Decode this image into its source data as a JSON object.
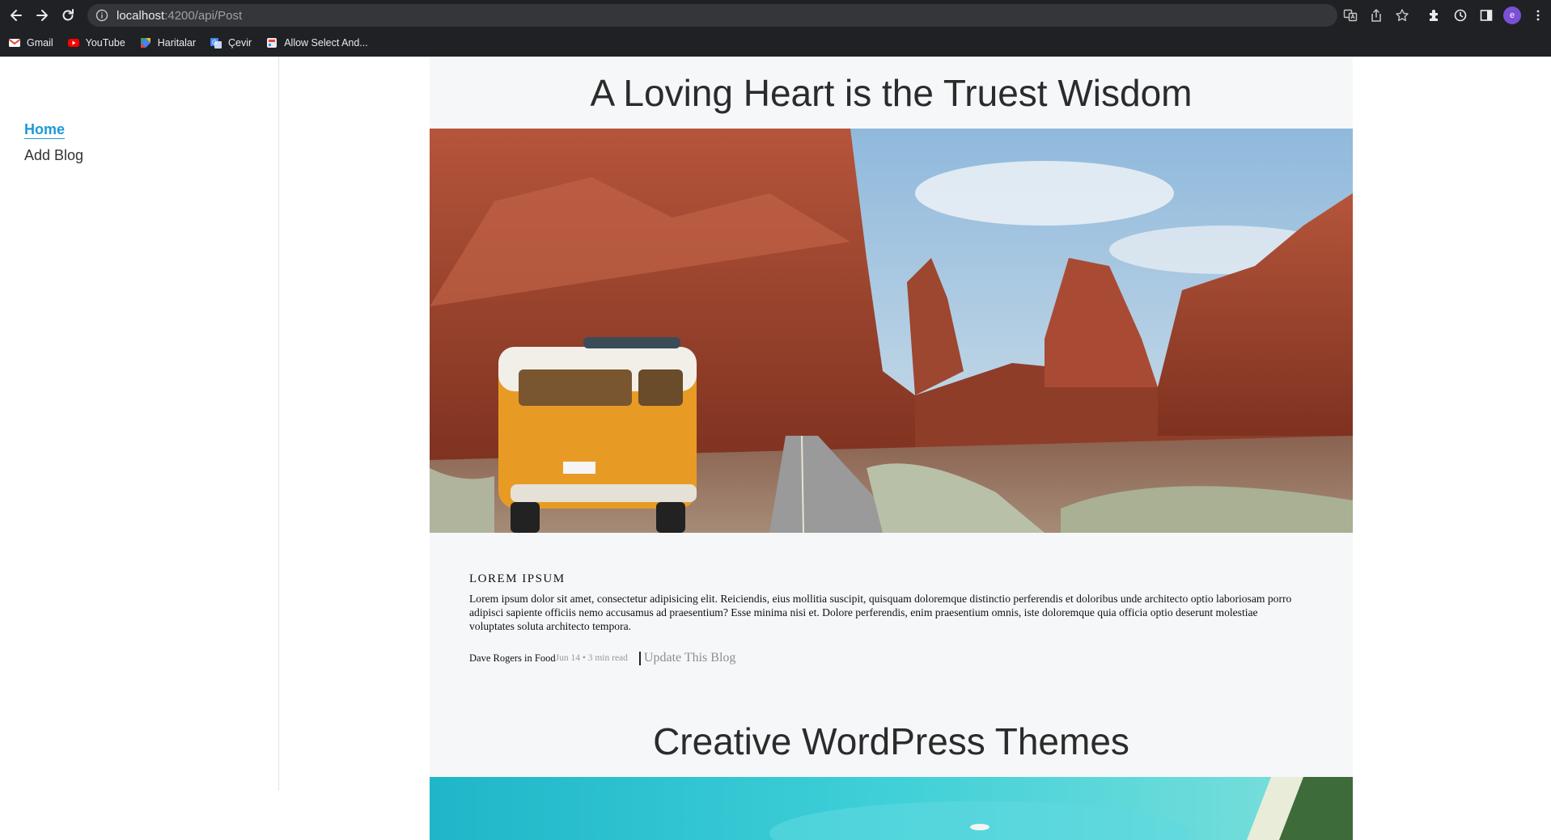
{
  "browser": {
    "url_host": "localhost",
    "url_path": ":4200/api/Post",
    "profile_initial": "e",
    "bookmarks": [
      {
        "label": "Gmail",
        "icon": "gmail-icon"
      },
      {
        "label": "YouTube",
        "icon": "youtube-icon"
      },
      {
        "label": "Haritalar",
        "icon": "maps-icon"
      },
      {
        "label": "Çevir",
        "icon": "translate-icon"
      },
      {
        "label": "Allow Select And...",
        "icon": "extension-icon"
      }
    ]
  },
  "sidebar": {
    "items": [
      {
        "label": "Home",
        "active": true
      },
      {
        "label": "Add Blog",
        "active": false
      }
    ]
  },
  "posts": [
    {
      "title": "A Loving Heart is the Truest Wisdom",
      "image": "desert-road-van-image",
      "category": "LOREM IPSUM",
      "excerpt": "Lorem ipsum dolor sit amet, consectetur adipisicing elit. Reiciendis, eius mollitia suscipit, quisquam doloremque distinctio perferendis et doloribus unde architecto optio laboriosam porro adipisci sapiente officiis nemo accusamus ad praesentium? Esse minima nisi et. Dolore perferendis, enim praesentium omnis, iste doloremque quia officia optio deserunt molestiae voluptates soluta architecto tempora.",
      "author": "Dave Rogers in Food",
      "date": "Jun 14 • 3 min read",
      "update_label": "Update This Blog"
    },
    {
      "title": "Creative WordPress Themes",
      "image": "aerial-beach-image"
    }
  ],
  "colors": {
    "accent": "#1a9bd8",
    "chrome": "#202124",
    "content_bg": "#f6f7f9"
  }
}
